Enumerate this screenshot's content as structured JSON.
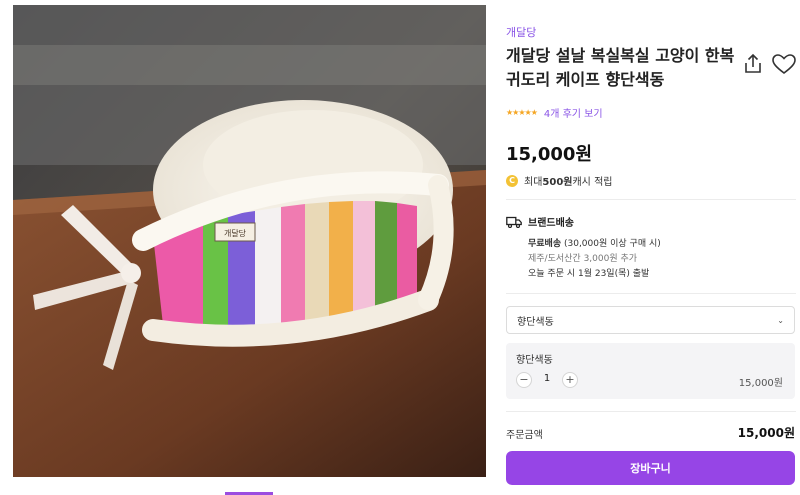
{
  "product": {
    "brand": "개달당",
    "title": "개달당 설날 복실복실 고양이 한복 귀도리 케이프 향단색동",
    "rating_stars": "★★★★★",
    "review_link": "4개 후기 보기",
    "price": "15,000원",
    "cash_prefix": "최대 ",
    "cash_amount": "500원",
    "cash_suffix": " 캐시 적립",
    "coin_symbol": "C"
  },
  "image": {
    "label_tag": "개달당"
  },
  "shipping": {
    "title": "브랜드배송",
    "free_bold": "무료배송",
    "free_rest": " (30,000원 이상 구매 시)",
    "island_note": "제주/도서산간 3,000원 추가",
    "dispatch": "오늘 주문 시 1월 23일(목) 출발"
  },
  "option": {
    "selected": "향단색동",
    "chevron": "⌄",
    "item_name": "향단색동",
    "minus": "−",
    "plus": "+",
    "quantity": "1",
    "item_price": "15,000원"
  },
  "order": {
    "total_label": "주문금액",
    "total_value": "15,000원",
    "cart_button": "장바구니"
  },
  "colors": {
    "accent": "#9645e6",
    "brand_text": "#8a55e6",
    "star": "#f5a623",
    "coin": "#f3c235"
  },
  "icons": {
    "share": "share-icon",
    "heart": "heart-icon",
    "truck": "truck-icon",
    "coin": "coin-icon"
  }
}
